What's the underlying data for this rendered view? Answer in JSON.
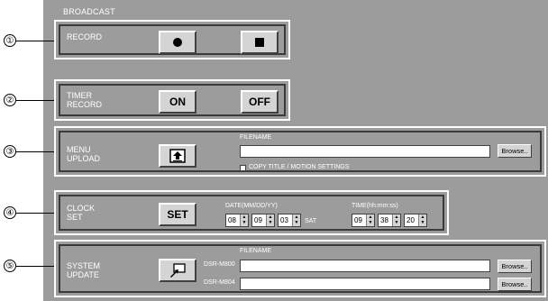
{
  "header": "BROADCAST",
  "markers": [
    "①",
    "②",
    "③",
    "④",
    "⑤"
  ],
  "record": {
    "label": "RECORD",
    "rec_icon": "record-dot-icon",
    "stop_icon": "stop-square-icon"
  },
  "timer": {
    "label": "TIMER\nRECORD",
    "on": "ON",
    "off": "OFF"
  },
  "menu": {
    "label": "MENU\nUPLOAD",
    "filename_label": "FILENAME",
    "browse": "Browse..",
    "checkbox_label": "COPY TITLE / MOTION SETTINGS",
    "upload_icon": "upload-icon"
  },
  "clock": {
    "label": "CLOCK\nSET",
    "set": "SET",
    "date_label": "DATE(MM/DD/YY)",
    "time_label": "TIME(hh:mm:ss)",
    "month": "08",
    "day": "09",
    "year": "03",
    "weekday": "SAT",
    "hour": "09",
    "minute": "38",
    "second": "20"
  },
  "system": {
    "label": "SYSTEM\nUPDATE",
    "filename_label": "FILENAME",
    "model1": "DSR-M800",
    "model2": "DSR-M804",
    "browse": "Browse..",
    "update_icon": "update-icon"
  }
}
